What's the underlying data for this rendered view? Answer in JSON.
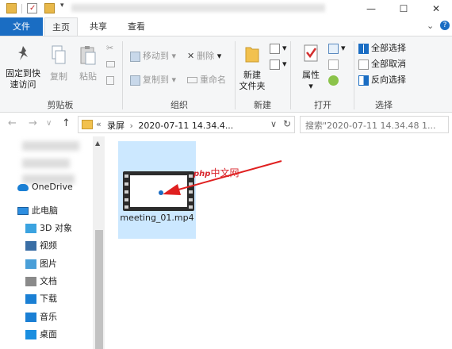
{
  "title_bar": {
    "quick_access_dropdown": "▾",
    "minimize": "—",
    "maximize": "☐",
    "close": "✕"
  },
  "tabs": {
    "file": "文件",
    "home": "主页",
    "share": "共享",
    "view": "查看",
    "expand": "⌄",
    "help": "?"
  },
  "ribbon": {
    "clipboard": {
      "label": "剪贴板",
      "pin": "固定到快\n速访问",
      "copy": "复制",
      "paste": "粘贴"
    },
    "organize": {
      "label": "组织",
      "move_to": "移动到",
      "copy_to": "复制到",
      "delete": "删除",
      "rename": "重命名"
    },
    "new": {
      "label": "新建",
      "new_folder": "新建\n文件夹"
    },
    "open": {
      "label": "打开",
      "properties": "属性"
    },
    "select": {
      "label": "选择",
      "select_all": "全部选择",
      "select_none": "全部取消",
      "invert": "反向选择"
    }
  },
  "address_bar": {
    "back": "←",
    "forward": "→",
    "recent": "∨",
    "up": "↑",
    "path_prefix": "«",
    "path_root": "录屏",
    "path_sep": "›",
    "path_folder": "2020-07-11 14.34.4...",
    "dropdown": "∨",
    "refresh": "↻",
    "search_placeholder": "搜索\"2020-07-11 14.34.48 1..."
  },
  "nav_pane": {
    "onedrive": "OneDrive",
    "this_pc": "此电脑",
    "items": [
      {
        "label": "3D 对象",
        "icon": "cube-icon",
        "color": "#3ba3e0"
      },
      {
        "label": "视频",
        "icon": "video-icon",
        "color": "#3a6ea5"
      },
      {
        "label": "图片",
        "icon": "pictures-icon",
        "color": "#4a9fd8"
      },
      {
        "label": "文档",
        "icon": "documents-icon",
        "color": "#8a8a8a"
      },
      {
        "label": "下载",
        "icon": "download-icon",
        "color": "#1a7fd4"
      },
      {
        "label": "音乐",
        "icon": "music-icon",
        "color": "#1a7fd4"
      },
      {
        "label": "桌面",
        "icon": "desktop-icon",
        "color": "#1a8ee0"
      }
    ]
  },
  "content": {
    "file_name": "meeting_01.mp4",
    "watermark_php": "php",
    "watermark_text": "中文网"
  },
  "colors": {
    "accent": "#1a6dc3",
    "selection": "#cce8ff",
    "arrow": "#e02020"
  }
}
